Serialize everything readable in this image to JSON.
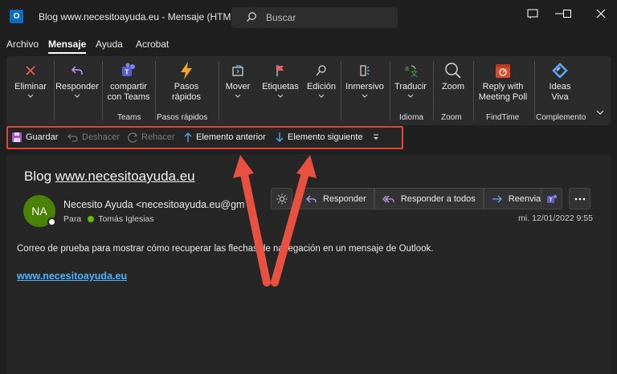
{
  "window": {
    "title": "Blog www.necesitoayuda.eu  -  Mensaje (HTML)",
    "search_placeholder": "Buscar",
    "app_icon_letter": "O"
  },
  "menu": {
    "tabs": [
      "Archivo",
      "Mensaje",
      "Ayuda",
      "Acrobat"
    ],
    "active": "Mensaje"
  },
  "ribbon": {
    "buttons": {
      "eliminar": "Eliminar",
      "responder": "Responder",
      "compartir_1": "compartir",
      "compartir_2": "con Teams",
      "pasos_1": "Pasos",
      "pasos_2": "rápidos",
      "mover": "Mover",
      "etiquetas": "Etiquetas",
      "edicion": "Edición",
      "inmersivo": "Inmersivo",
      "traducir": "Traducir",
      "zoom": "Zoom",
      "reply_1": "Reply with",
      "reply_2": "Meeting Poll",
      "ideas_1": "Ideas",
      "ideas_2": "Viva"
    },
    "groups": {
      "teams": "Teams",
      "pasos": "Pasos rápidos",
      "idioma": "Idioma",
      "zoom": "Zoom",
      "findtime": "FindTime",
      "complemento": "Complemento"
    }
  },
  "quick_access": {
    "guardar": "Guardar",
    "deshacer": "Deshacer",
    "rehacer": "Rehacer",
    "anterior": "Elemento anterior",
    "siguiente": "Elemento siguiente"
  },
  "message": {
    "subject_prefix": "Blog ",
    "subject_link": "www.necesitoayuda.eu",
    "avatar_initials": "NA",
    "sender": "Necesito Ayuda <necesitoayuda.eu@gm",
    "to_label": "Para",
    "to_name": "Tomás Iglesias",
    "date": "mi. 12/01/2022 9:55",
    "body": "Correo de prueba para mostrar cómo recuperar las flechas de navegación en un mensaje de Outlook.",
    "link": "www.necesitoayuda.eu",
    "actions": {
      "responder": "Responder",
      "responder_todos": "Responder a todos",
      "reenviar": "Reenviar"
    }
  },
  "colors": {
    "accent_red": "#e0453a",
    "link_blue": "#4fb3ff",
    "avatar_green": "#498205",
    "presence_green": "#6bb700"
  }
}
